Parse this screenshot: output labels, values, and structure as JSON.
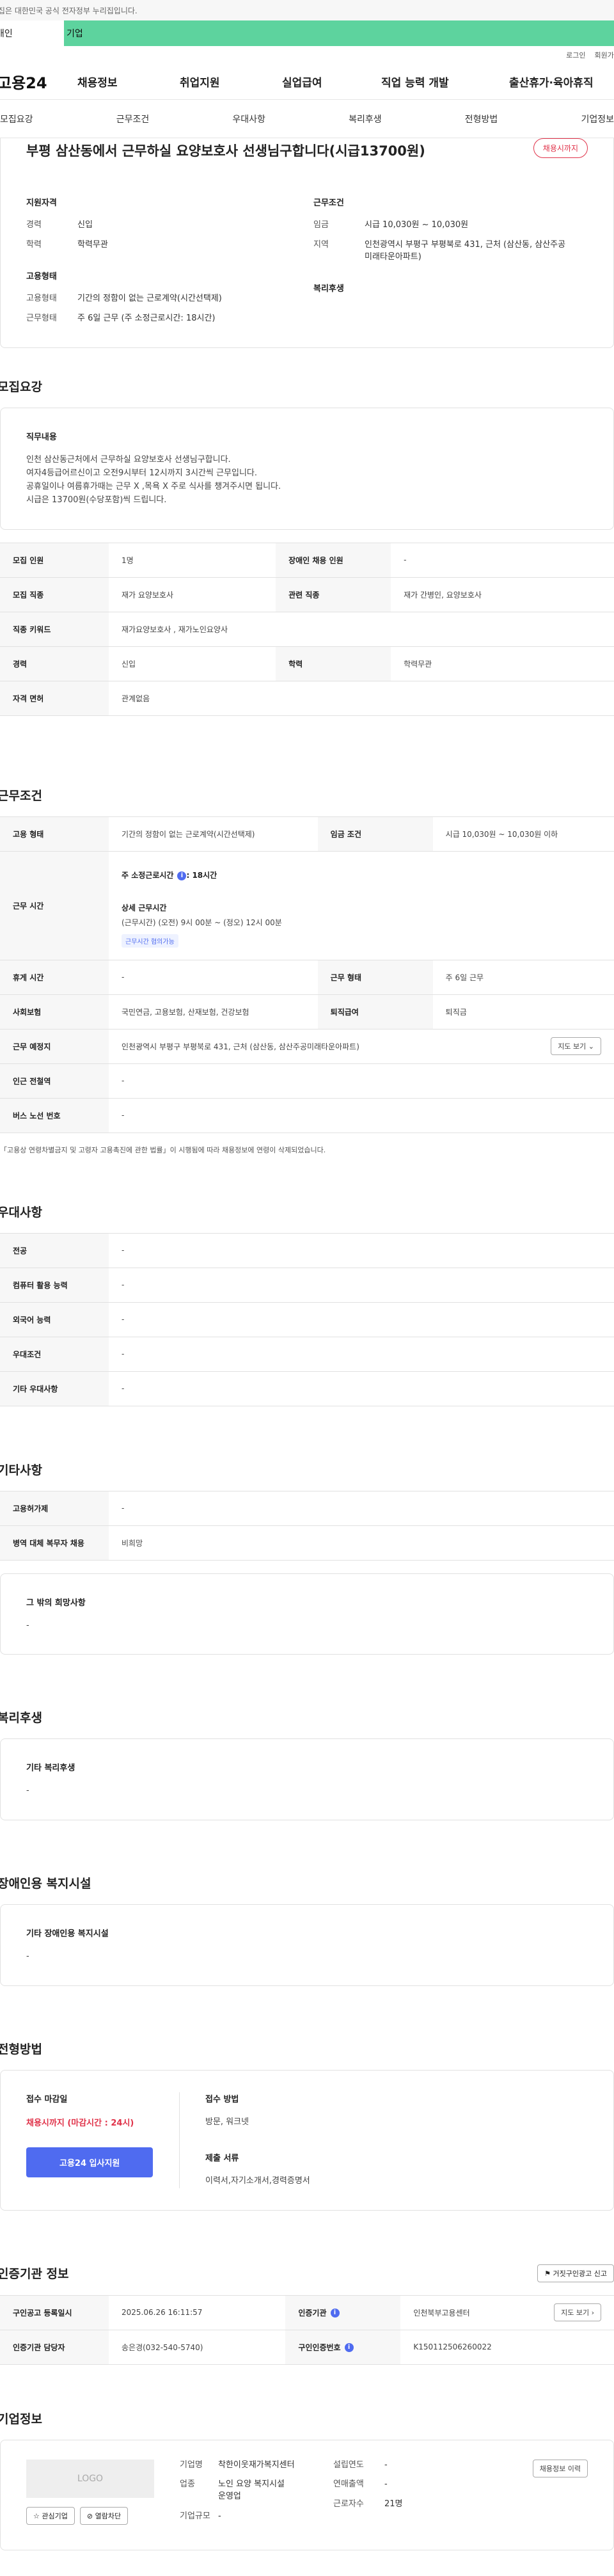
{
  "gov_bar": "이 누리집은 대한민국 공식 전자정부 누리집입니다.",
  "type_tabs": [
    "개인",
    "기업"
  ],
  "utility": [
    "로그인",
    "회원가입"
  ],
  "logo": "고용24",
  "gnb": [
    "채용정보",
    "취업지원",
    "실업급여",
    "직업 능력 개발",
    "출산휴가·육아휴직"
  ],
  "subnav": [
    "모집요강",
    "근무조건",
    "우대사항",
    "복리후생",
    "전형방법",
    "기업정보"
  ],
  "job": {
    "title": "부평 삼산동에서 근무하실 요양보호사 선생님구합니다(시급13700원)",
    "status": "채용시까지",
    "qual_title": "지원자격",
    "qual": [
      {
        "k": "경력",
        "v": "신입"
      },
      {
        "k": "학력",
        "v": "학력무관"
      }
    ],
    "cond_title": "근무조건",
    "cond": [
      {
        "k": "임금",
        "v": "시급 10,030원 ~ 10,030원"
      },
      {
        "k": "지역",
        "v": "인천광역시 부평구 부평북로 431, 근처 (삼산동, 삼산주공미래타운아파트)"
      }
    ],
    "emp_title": "고용형태",
    "emp": [
      {
        "k": "고용형태",
        "v": "기간의 정함이 없는 근로계약(시간선택제)"
      },
      {
        "k": "근무형태",
        "v": "주 6일 근무 (주 소정근로시간: 18시간)"
      }
    ],
    "welfare_title": "복리후생"
  },
  "recruit": {
    "title": "모집요강",
    "duty_title": "직무내용",
    "duty_lines": [
      "인천 삼산동근처에서 근무하실 요양보호사 선생님구합니다.",
      "여자4등급어르신이고 오전9시부터 12시까지 3시간씩 근무입니다.",
      "공휴일이나 여름휴가때는 근무 X ,목욕 X 주로 식사를 챙겨주시면 됩니다.",
      "시급은 13700원(수당포함)씩 드립니다."
    ],
    "rows": [
      {
        "k1": "모집 인원",
        "v1": "1명",
        "k2": "장애인 채용 인원",
        "v2": "-"
      },
      {
        "k1": "모집 직종",
        "v1": "재가 요양보호사",
        "k2": "관련 직종",
        "v2": "재가 간병인, 요양보호사"
      },
      {
        "k1": "직종 키워드",
        "v1": "재가요양보호사 , 재가노인요양사"
      },
      {
        "k1": "경력",
        "v1": "신입",
        "k2": "학력",
        "v2": "학력무관"
      },
      {
        "k1": "자격 면허",
        "v1": "관계없음"
      }
    ]
  },
  "work": {
    "title": "근무조건",
    "emp_k": "고용 형태",
    "emp_v": "기간의 정함이 없는 근로계약(시간선택제)",
    "wage_k": "임금 조건",
    "wage_v": "시급 10,030원 ~ 10,030원 이하",
    "time_k": "근무 시간",
    "time_hours": "주 소정근로시간",
    "time_hours_v": ": 18시간",
    "time_detail_title": "상세 근무시간",
    "time_detail": "(근무시간) (오전) 9시 00분 ~ (정오) 12시 00분",
    "time_tag": "근무시간 협의가능",
    "rows": [
      {
        "k1": "휴게 시간",
        "v1": "-",
        "k2": "근무 형태",
        "v2": "주 6일 근무"
      },
      {
        "k1": "사회보험",
        "v1": "국민연금, 고용보험, 산재보험, 건강보험",
        "k2": "퇴직급여",
        "v2": "퇴직금"
      }
    ],
    "place_k": "근무 예정지",
    "place_v": "인천광역시 부평구 부평북로 431, 근처 (삼산동, 삼산주공미래타운아파트)",
    "map_btn": "지도 보기",
    "station_k": "인근 전철역",
    "station_v": "-",
    "bus_k": "버스 노선 번호",
    "bus_v": "-",
    "note": "「고용상 연령차별금지 및 고령자 고용촉진에 관한 법률」이 시행됨에 따라 채용정보에 연령이 삭제되었습니다."
  },
  "pref": {
    "title": "우대사항",
    "rows": [
      {
        "k": "전공",
        "v": "-"
      },
      {
        "k": "컴퓨터 활용 능력",
        "v": "-"
      },
      {
        "k": "외국어 능력",
        "v": "-"
      },
      {
        "k": "우대조건",
        "v": "-"
      },
      {
        "k": "기타 우대사항",
        "v": "-"
      }
    ]
  },
  "etc": {
    "title": "기타사항",
    "rows": [
      {
        "k": "고용허가제",
        "v": "-"
      },
      {
        "k": "병역 대체 복무자 채용",
        "v": "비희망"
      }
    ],
    "other_title": "그 밖의 희망사항",
    "other_v": "-"
  },
  "welfare": {
    "title": "복리후생",
    "box_title": "기타 복리후생",
    "v": "-"
  },
  "disability": {
    "title": "장애인용 복지시설",
    "box_title": "기타 장애인용 복지시설",
    "v": "-"
  },
  "select": {
    "title": "전형방법",
    "deadline_title": "접수 마감일",
    "deadline_v": "채용시까지 (마감시간 : 24시)",
    "apply_btn": "고용24 입사지원",
    "method_title": "접수 방법",
    "method_v": "방문, 워크넷",
    "docs_title": "제출 서류",
    "docs_v": "이력서,자기소개서,경력증명서"
  },
  "cert": {
    "title": "인증기관 정보",
    "report_btn": "거짓구인광고 신고",
    "rows": [
      {
        "k1": "구인공고 등록일시",
        "v1": "2025.06.26 16:11:57",
        "k2": "인증기관",
        "v2": "인천북부고용센터"
      },
      {
        "k1": "인증기관 담당자",
        "v1": "송은경(032-540-5740)",
        "k2": "구인인증번호",
        "v2": "K150112506260022"
      }
    ],
    "map_btn": "지도 보기"
  },
  "company": {
    "title": "기업정보",
    "logo_text": "LOGO",
    "interest_btn": "관심기업",
    "block_btn": "열람차단",
    "name_k": "기업명",
    "name_v": "착한이웃재가복지센터",
    "industry_k": "업종",
    "industry_v": "노인 요양 복지시설 운영업",
    "scale_k": "기업규모",
    "scale_v": "-",
    "founded_k": "설립연도",
    "founded_v": "-",
    "sales_k": "연매출액",
    "sales_v": "-",
    "emp_k": "근로자수",
    "emp_v": "21명",
    "history_btn": "채용정보 이력"
  }
}
